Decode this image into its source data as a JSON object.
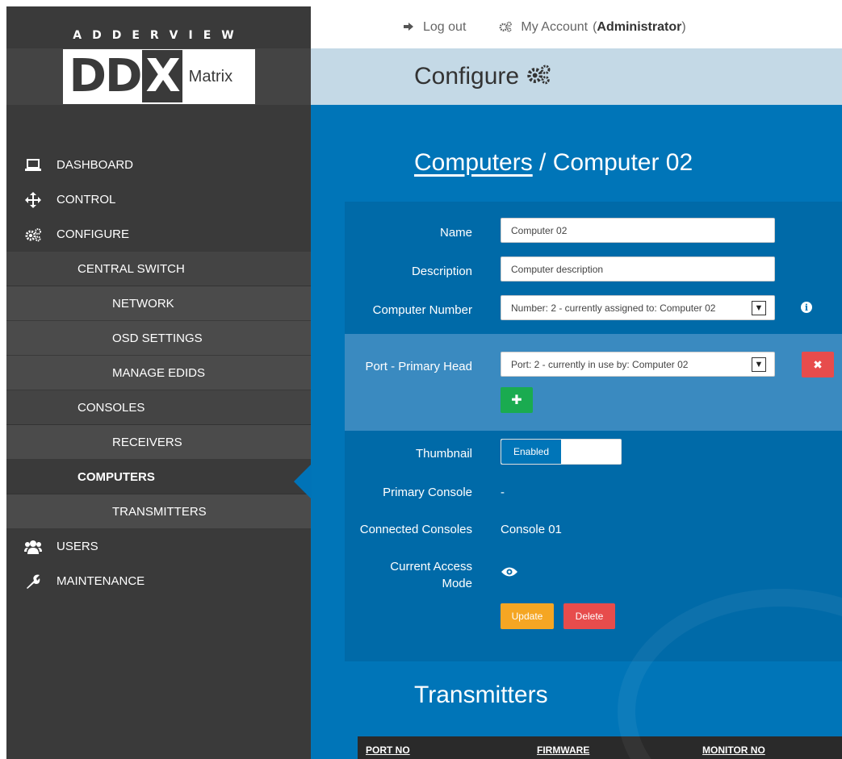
{
  "brand": {
    "maker": "ADDERVIEW",
    "logo_main": "DD",
    "logo_x": "X",
    "logo_sub": "Matrix"
  },
  "topbar": {
    "logout": "Log out",
    "my_account": "My Account",
    "role": "Administrator"
  },
  "page_header": {
    "title": "Configure"
  },
  "sidebar": {
    "items": [
      {
        "label": "DASHBOARD",
        "icon": "laptop-icon"
      },
      {
        "label": "CONTROL",
        "icon": "move-arrows-icon"
      },
      {
        "label": "CONFIGURE",
        "icon": "gears-icon"
      },
      {
        "label": "CENTRAL SWITCH"
      },
      {
        "label": "NETWORK"
      },
      {
        "label": "OSD SETTINGS"
      },
      {
        "label": "MANAGE EDIDS"
      },
      {
        "label": "CONSOLES"
      },
      {
        "label": "RECEIVERS"
      },
      {
        "label": "COMPUTERS"
      },
      {
        "label": "TRANSMITTERS"
      },
      {
        "label": "USERS",
        "icon": "users-icon"
      },
      {
        "label": "MAINTENANCE",
        "icon": "wrench-icon"
      }
    ]
  },
  "breadcrumb": {
    "parent": "Computers",
    "separator": " / ",
    "current": "Computer 02"
  },
  "form": {
    "name_label": "Name",
    "name_value": "Computer 02",
    "description_label": "Description",
    "description_value": "Computer description",
    "computer_number_label": "Computer Number",
    "computer_number_value": "Number: 2 - currently assigned to: Computer 02",
    "port_label": "Port - Primary Head",
    "port_value": "Port: 2 - currently in use by: Computer 02",
    "thumbnail_label": "Thumbnail",
    "thumbnail_value": "Enabled",
    "primary_console_label": "Primary Console",
    "primary_console_value": "-",
    "connected_consoles_label": "Connected Consoles",
    "connected_consoles_value": "Console 01",
    "access_mode_label_1": "Current Access",
    "access_mode_label_2": "Mode",
    "update_button": "Update",
    "delete_button": "Delete"
  },
  "transmitters": {
    "title": "Transmitters",
    "columns": [
      "PORT NO",
      "FIRMWARE",
      "MONITOR NO"
    ]
  },
  "colors": {
    "sidebar_bg": "#3a3a3a",
    "main_blue": "#0075b8",
    "header_band": "#c4d9e6",
    "danger": "#e74c4c",
    "success": "#1aab50",
    "warning": "#f5a623"
  }
}
